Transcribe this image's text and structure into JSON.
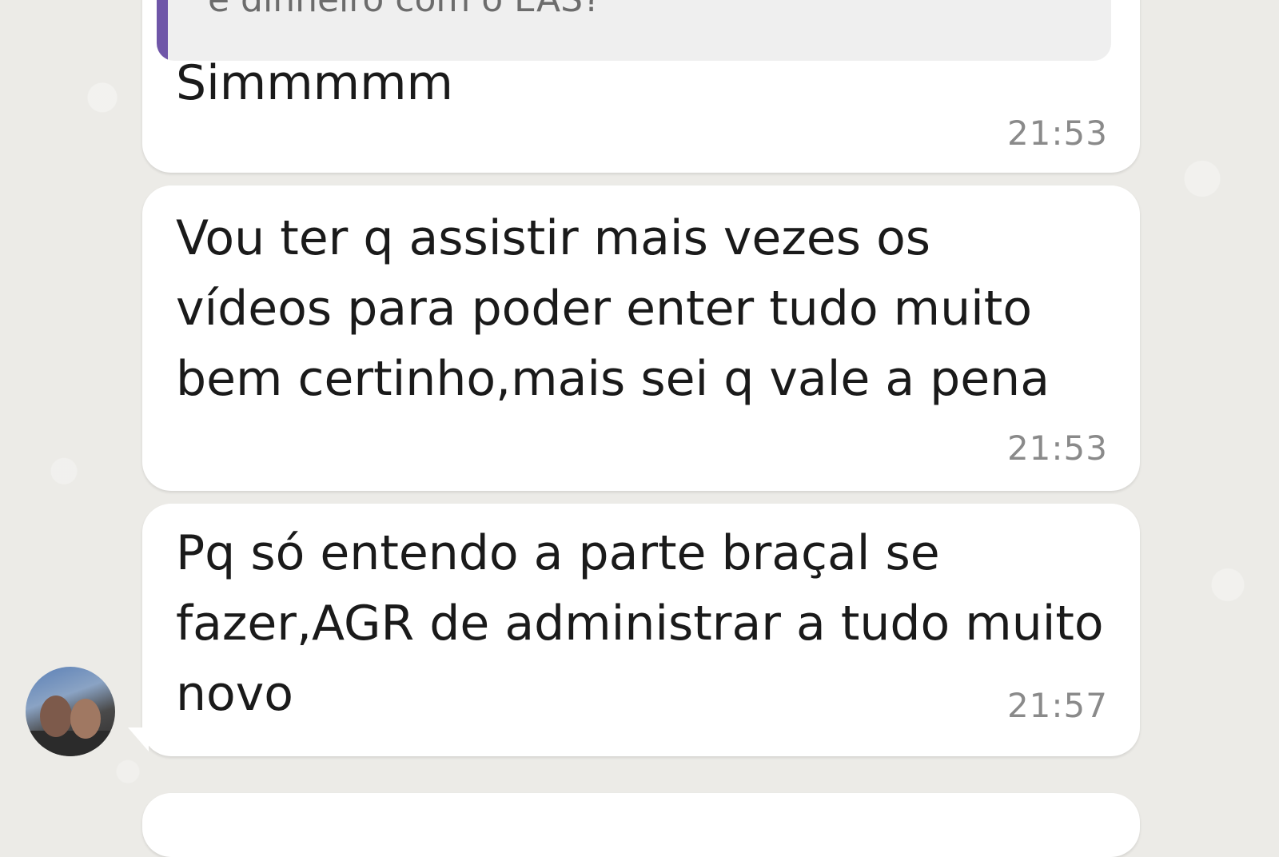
{
  "chat": {
    "messages": [
      {
        "quote": "e dinheiro com o EAS?",
        "text": "Simmmmm",
        "time": "21:53"
      },
      {
        "text": "Vou ter q assistir mais vezes os\nvídeos para poder enter tudo muito\nbem certinho,mais sei q vale a pena",
        "time": "21:53"
      },
      {
        "text": "Pq só entendo a parte braçal se\nfazer,AGR de administrar a tudo muito\nnovo",
        "time": "21:57"
      }
    ]
  },
  "colors": {
    "background": "#ecebe7",
    "bubble": "#ffffff",
    "quote_bar": "#6f56a8",
    "timestamp": "#8a8a8a"
  }
}
